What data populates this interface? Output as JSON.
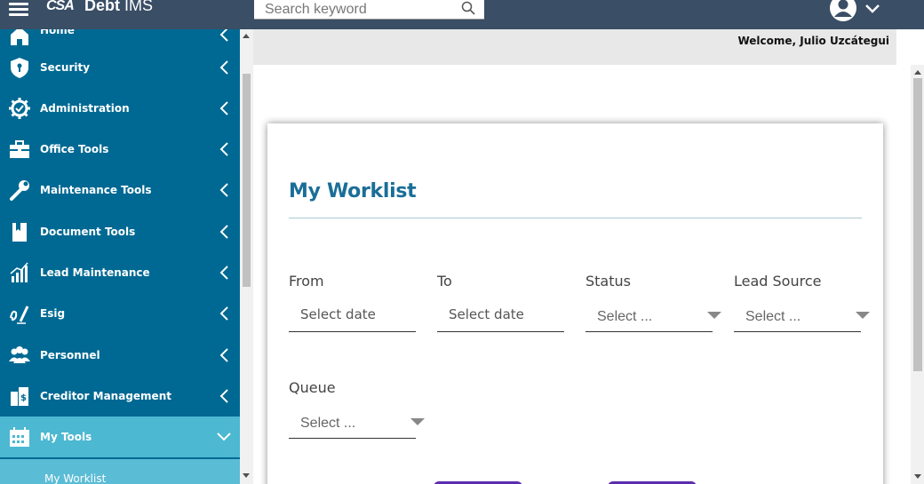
{
  "header": {
    "logo": "CSA",
    "app_name_bold": "Debt",
    "app_name": " IMS",
    "search": {
      "placeholder": "Search keyword",
      "value": ""
    }
  },
  "sidebar": {
    "items": [
      {
        "label": "Home",
        "icon": "home-icon"
      },
      {
        "label": "Security",
        "icon": "shield-icon"
      },
      {
        "label": "Administration",
        "icon": "gear-check-icon"
      },
      {
        "label": "Office Tools",
        "icon": "briefcase-icon"
      },
      {
        "label": "Maintenance Tools",
        "icon": "wrench-icon"
      },
      {
        "label": "Document Tools",
        "icon": "book-icon"
      },
      {
        "label": "Lead Maintenance",
        "icon": "bar-chart-icon"
      },
      {
        "label": "Esig",
        "icon": "signature-icon"
      },
      {
        "label": "Personnel",
        "icon": "people-icon"
      },
      {
        "label": "Creditor Management",
        "icon": "building-icon"
      },
      {
        "label": "My Tools",
        "icon": "calendar-icon"
      }
    ],
    "active_sub_item": "My Worklist"
  },
  "welcome_text": "Welcome, Julio Uzcátegui",
  "worklist": {
    "title": "My Worklist",
    "filters": {
      "from": {
        "label": "From",
        "placeholder": "Select date"
      },
      "to": {
        "label": "To",
        "placeholder": "Select date"
      },
      "status": {
        "label": "Status",
        "value": "Select ..."
      },
      "lead_source": {
        "label": "Lead Source",
        "value": "Select ..."
      },
      "queue": {
        "label": "Queue",
        "value": "Select ..."
      }
    }
  },
  "colors": {
    "topbar": "#3a4e66",
    "sidebar": "#006993",
    "sidebar_active": "#4cb8d1",
    "title": "#1a6e98",
    "button": "#5b2db0"
  }
}
